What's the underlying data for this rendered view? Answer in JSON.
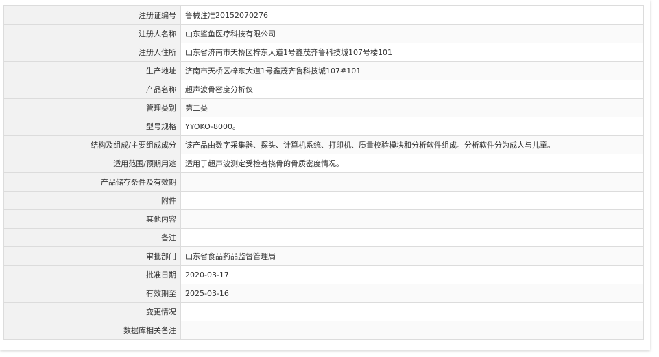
{
  "record": {
    "rows": [
      {
        "label": "注册证编号",
        "value": "鲁械注准20152070276"
      },
      {
        "label": "注册人名称",
        "value": "山东鲨鱼医疗科技有限公司"
      },
      {
        "label": "注册人住所",
        "value": "山东省济南市天桥区梓东大道1号鑫茂齐鲁科技城107号楼101"
      },
      {
        "label": "生产地址",
        "value": "济南市天桥区梓东大道1号鑫茂齐鲁科技城107#101"
      },
      {
        "label": "产品名称",
        "value": "超声波骨密度分析仪"
      },
      {
        "label": "管理类别",
        "value": "第二类"
      },
      {
        "label": "型号规格",
        "value": "YYOKO-8000。"
      },
      {
        "label": "结构及组成/主要组成成分",
        "value": "该产品由数字采集器、探头、计算机系统、打印机、质量校验模块和分析软件组成。分析软件分为成人与儿童。"
      },
      {
        "label": "适用范围/预期用途",
        "value": "适用于超声波测定受检者桡骨的骨质密度情况。"
      },
      {
        "label": "产品储存条件及有效期",
        "value": ""
      },
      {
        "label": "附件",
        "value": ""
      },
      {
        "label": "其他内容",
        "value": ""
      },
      {
        "label": "备注",
        "value": ""
      },
      {
        "label": "审批部门",
        "value": "山东省食品药品监督管理局"
      },
      {
        "label": "批准日期",
        "value": "2020-03-17"
      },
      {
        "label": "有效期至",
        "value": "2025-03-16"
      },
      {
        "label": "变更情况",
        "value": ""
      },
      {
        "label": "数据库相关备注",
        "value": ""
      }
    ]
  }
}
